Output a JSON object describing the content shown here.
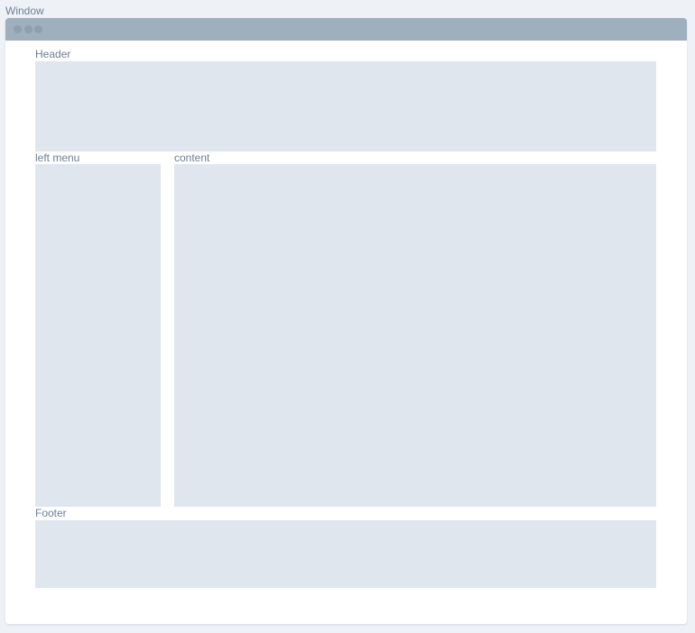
{
  "diagram": {
    "window_label": "Window",
    "header_label": "Header",
    "left_menu_label": "left menu",
    "content_label": "content",
    "footer_label": "Footer"
  },
  "colors": {
    "page_background": "#eef2f6",
    "window_background": "#ffffff",
    "titlebar": "#9eafbd",
    "titlebar_dots": "#8e9fad",
    "region_fill": "#dfe6ee",
    "label_text": "#6d7f95"
  }
}
